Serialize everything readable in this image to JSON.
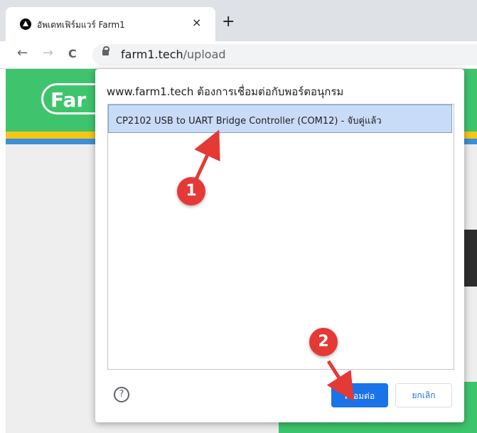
{
  "browser": {
    "tab_title": "อัพเดทเฟิร์มแวร์ Farm1",
    "close_glyph": "×",
    "new_tab_glyph": "+",
    "back_glyph": "←",
    "forward_glyph": "→",
    "reload_glyph": "C",
    "url_host": "farm1.tech",
    "url_path": "/upload"
  },
  "page": {
    "logo_text": "Far"
  },
  "dialog": {
    "title": "www.farm1.tech ต้องการเชื่อมต่อกับพอร์ตอนุกรม",
    "ports": [
      {
        "label": "CP2102 USB to UART Bridge Controller (COM12) - จับคู่แล้ว",
        "selected": true
      }
    ],
    "help_glyph": "?",
    "connect_label": "เชื่อมต่อ",
    "cancel_label": "ยกเลิก"
  },
  "annotations": {
    "step1": "1",
    "step2": "2",
    "color": "#e53935"
  },
  "colors": {
    "accent": "#1a73e8",
    "brand_green": "#3ec46d",
    "selection": "#c9dcf7"
  }
}
